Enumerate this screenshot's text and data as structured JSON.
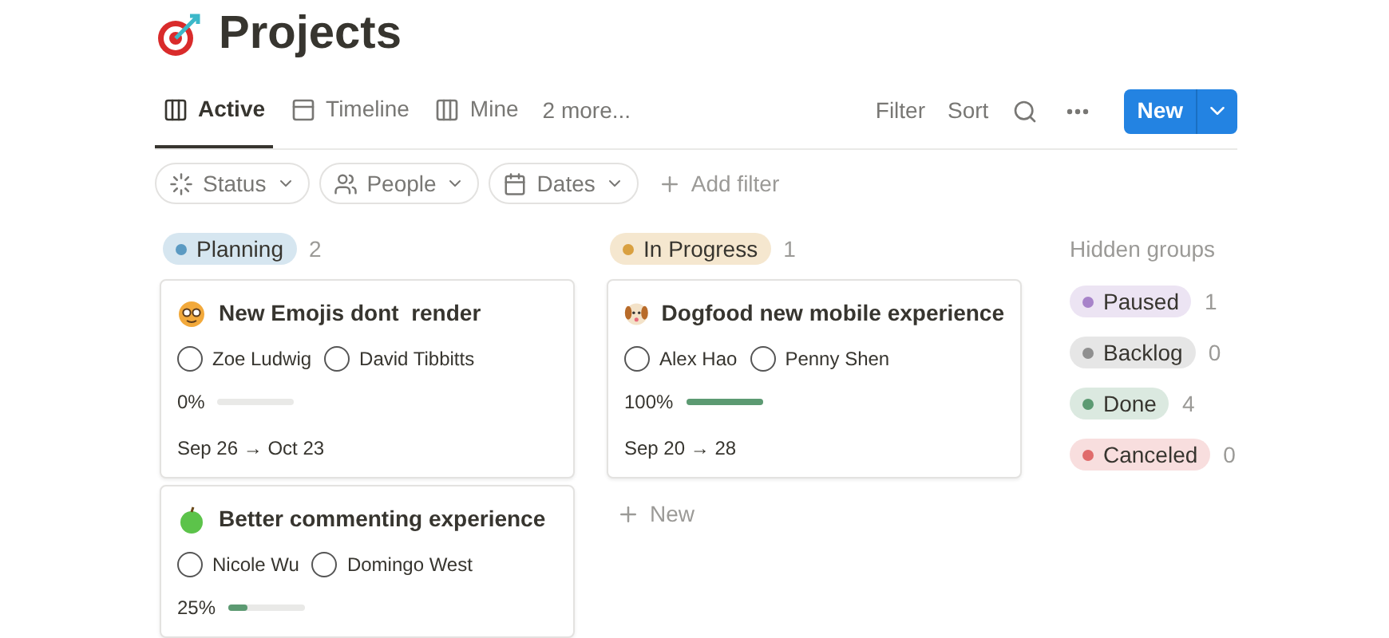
{
  "title": "Projects",
  "tabs": [
    {
      "label": "Active",
      "selected": true,
      "kind": "board"
    },
    {
      "label": "Timeline",
      "selected": false,
      "kind": "timeline"
    },
    {
      "label": "Mine",
      "selected": false,
      "kind": "board"
    }
  ],
  "more_tabs": "2 more...",
  "toolbar": {
    "filter": "Filter",
    "sort": "Sort",
    "new": "New"
  },
  "filters": [
    {
      "label": "Status",
      "kind": "status"
    },
    {
      "label": "People",
      "kind": "people"
    },
    {
      "label": "Dates",
      "kind": "dates"
    }
  ],
  "add_filter": "Add filter",
  "groups": [
    {
      "name": "Planning",
      "count": "2",
      "color": "#5b9ac2",
      "cards": [
        {
          "title": "New Emojis dont  render",
          "people": [
            "Zoe Ludwig",
            "David Tibbitts"
          ],
          "progress": "0%",
          "level": 0,
          "dates": "Sep 26 → Oct 23"
        },
        {
          "title": "Better commenting experience",
          "people": [
            "Nicole Wu",
            "Domingo West"
          ],
          "progress": "25%",
          "level": 0.25
        }
      ]
    },
    {
      "name": "In Progress",
      "count": "1",
      "color": "#d9a040",
      "new_label": "New",
      "cards": [
        {
          "title": "Dogfood new mobile experience",
          "people": [
            "Alex Hao",
            "Penny Shen"
          ],
          "progress": "100%",
          "level": 1,
          "dates": "Sep 20 → 28"
        }
      ]
    }
  ],
  "hidden_groups": {
    "title": "Hidden groups",
    "items": [
      {
        "name": "Paused",
        "count": "1",
        "color": "#a783c9"
      },
      {
        "name": "Backlog",
        "count": "0",
        "color": "#8f8f8f"
      },
      {
        "name": "Done",
        "count": "4",
        "color": "#5c9a72"
      },
      {
        "name": "Canceled",
        "count": "0",
        "color": "#e06b6b"
      }
    ]
  }
}
